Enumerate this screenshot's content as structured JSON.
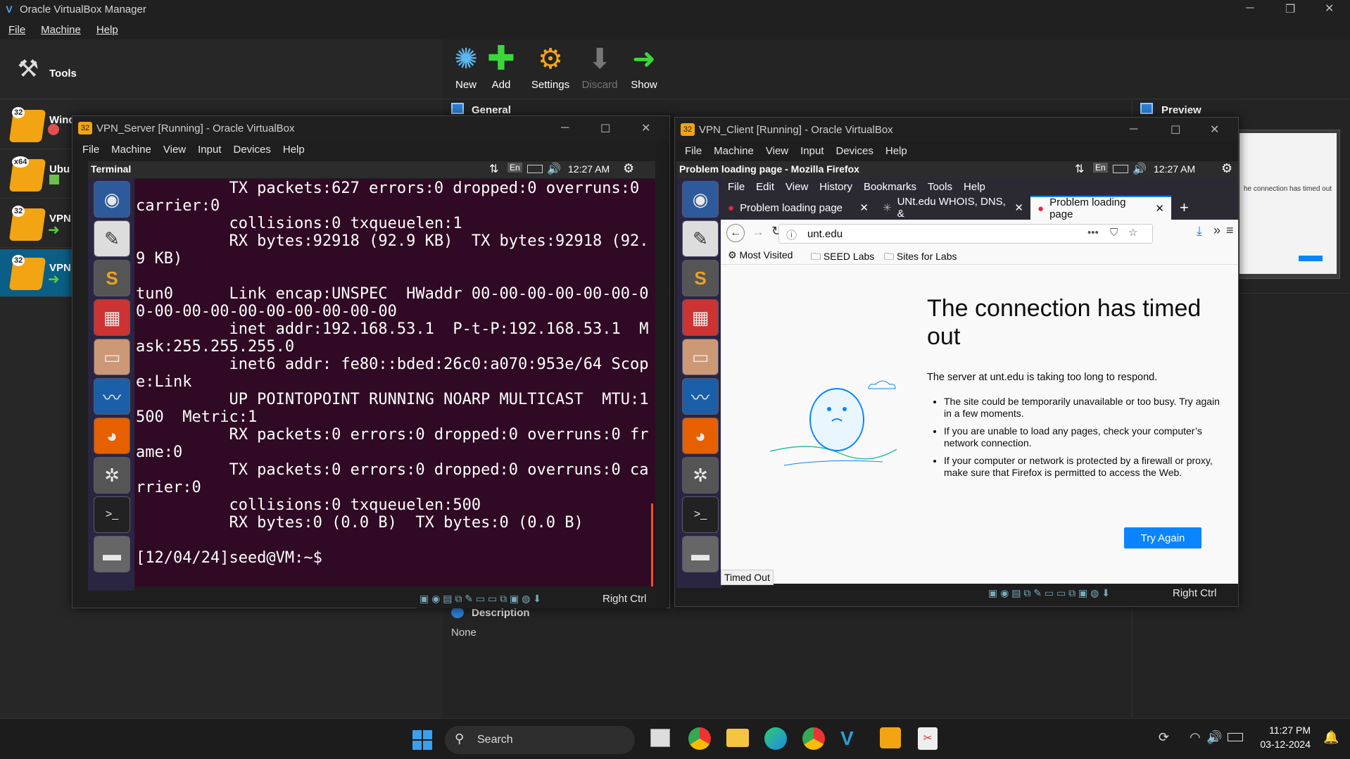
{
  "manager": {
    "title": "Oracle VirtualBox Manager",
    "menu": [
      "File",
      "Machine",
      "Help"
    ],
    "tools_label": "Tools",
    "vms": [
      {
        "name": "Windows",
        "badge": "32",
        "state": "stopped"
      },
      {
        "name": "Ubu",
        "badge": "x64",
        "state": "saved"
      },
      {
        "name": "VPN",
        "badge": "32",
        "state": "running"
      },
      {
        "name": "VPN",
        "badge": "32",
        "state": "running",
        "selected": true
      }
    ],
    "toolbar": {
      "new": "New",
      "add": "Add",
      "settings": "Settings",
      "discard": "Discard",
      "show": "Show"
    },
    "sections": {
      "general": "General",
      "preview": "Preview",
      "description": "Description",
      "description_value": "None"
    },
    "preview_text": "he connection has timed out"
  },
  "server_window": {
    "title": "VPN_Server [Running] - Oracle VirtualBox",
    "menu": [
      "File",
      "Machine",
      "View",
      "Input",
      "Devices",
      "Help"
    ],
    "topbar_app": "Terminal",
    "topbar_lang": "En",
    "topbar_time": "12:27 AM",
    "terminal_lines": [
      "          TX packets:627 errors:0 dropped:0 overruns:0",
      "carrier:0",
      "          collisions:0 txqueuelen:1",
      "          RX bytes:92918 (92.9 KB)  TX bytes:92918 (92.",
      "9 KB)",
      "",
      "tun0      Link encap:UNSPEC  HWaddr 00-00-00-00-00-00-0",
      "0-00-00-00-00-00-00-00-00-00",
      "          inet addr:192.168.53.1  P-t-P:192.168.53.1  M",
      "ask:255.255.255.0",
      "          inet6 addr: fe80::bded:26c0:a070:953e/64 Scop",
      "e:Link",
      "          UP POINTOPOINT RUNNING NOARP MULTICAST  MTU:1",
      "500  Metric:1",
      "          RX packets:0 errors:0 dropped:0 overruns:0 fr",
      "ame:0",
      "          TX packets:0 errors:0 dropped:0 overruns:0 ca",
      "rrier:0",
      "          collisions:0 txqueuelen:500",
      "          RX bytes:0 (0.0 B)  TX bytes:0 (0.0 B)",
      "",
      "[12/04/24]seed@VM:~$"
    ],
    "host_key": "Right Ctrl"
  },
  "client_window": {
    "title": "VPN_Client [Running] - Oracle VirtualBox",
    "menu": [
      "File",
      "Machine",
      "View",
      "Input",
      "Devices",
      "Help"
    ],
    "topbar_app": "Problem loading page - Mozilla Firefox",
    "topbar_lang": "En",
    "topbar_time": "12:27 AM",
    "host_key": "Right Ctrl"
  },
  "firefox": {
    "menu": [
      "File",
      "Edit",
      "View",
      "History",
      "Bookmarks",
      "Tools",
      "Help"
    ],
    "tabs": [
      {
        "title": "Problem loading page",
        "active": false
      },
      {
        "title": "UNt.edu WHOIS, DNS, &",
        "active": false
      },
      {
        "title": "Problem loading page",
        "active": true
      }
    ],
    "url": "unt.edu",
    "bookmarks": [
      "Most Visited",
      "SEED Labs",
      "Sites for Labs"
    ],
    "error": {
      "heading": "The connection has timed out",
      "lead": "The server at unt.edu is taking too long to respond.",
      "bullets": [
        "The site could be temporarily unavailable or too busy. Try again in a few moments.",
        "If you are unable to load any pages, check your computer’s network connection.",
        "If your computer or network is protected by a firewall or proxy, make sure that Firefox is permitted to access the Web."
      ],
      "button": "Try Again"
    },
    "status": "Timed Out"
  },
  "taskbar": {
    "search_placeholder": "Search",
    "time": "11:27 PM",
    "date": "03-12-2024"
  }
}
